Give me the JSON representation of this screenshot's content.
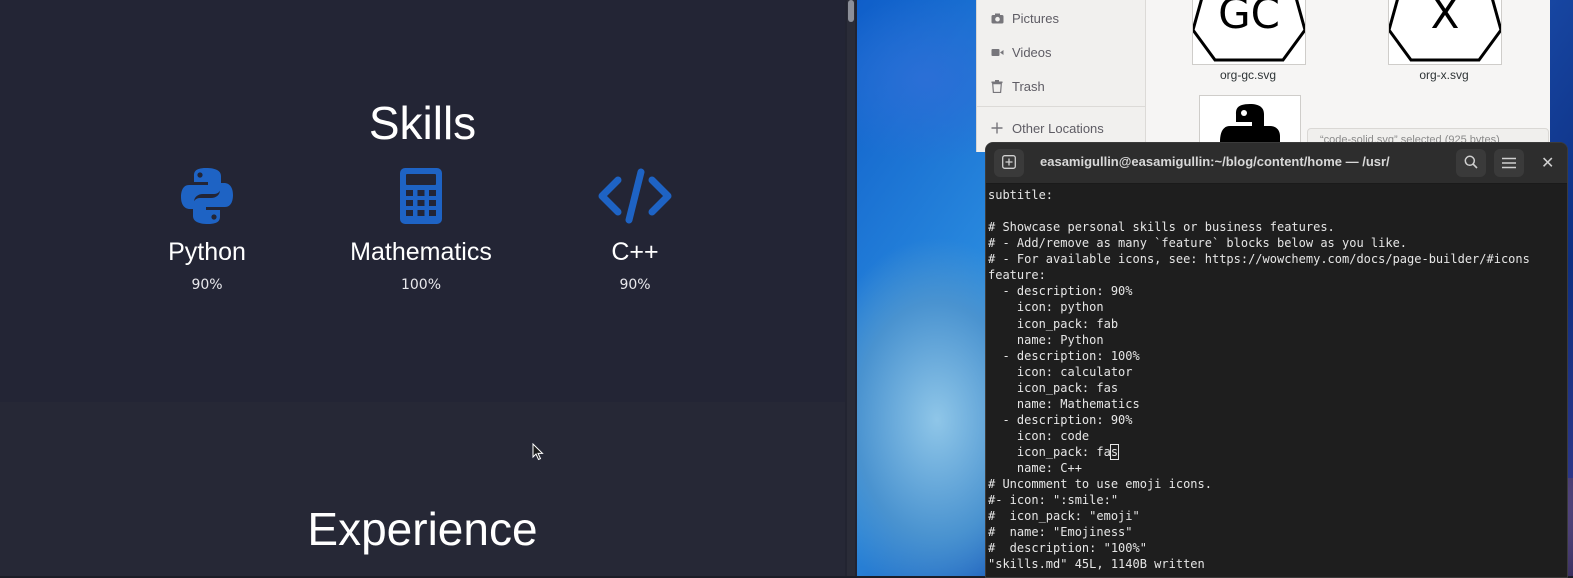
{
  "browser": {
    "skills_title": "Skills",
    "experience_title": "Experience",
    "features": [
      {
        "name": "Python",
        "description": "90%",
        "icon": "python-icon"
      },
      {
        "name": "Mathematics",
        "description": "100%",
        "icon": "calculator-icon"
      },
      {
        "name": "C++",
        "description": "90%",
        "icon": "code-icon"
      }
    ],
    "icon_color": "#1e63c4"
  },
  "file_manager": {
    "sidebar": [
      {
        "label": "Pictures",
        "icon": "camera-icon"
      },
      {
        "label": "Videos",
        "icon": "video-icon"
      },
      {
        "label": "Trash",
        "icon": "trash-icon"
      },
      {
        "label": "Other Locations",
        "icon": "plus-icon"
      }
    ],
    "files": [
      {
        "name": "org-gc.svg",
        "glyph": "GC"
      },
      {
        "name": "org-x.svg",
        "glyph": "X"
      }
    ],
    "status": "“code-solid.svg” selected (925 bytes)"
  },
  "terminal": {
    "title": "easamigullin@easamigullin:~/blog/content/home — /usr/libexe...",
    "lines": [
      "subtitle:",
      "",
      "# Showcase personal skills or business features.",
      "# - Add/remove as many `feature` blocks below as you like.",
      "# - For available icons, see: https://wowchemy.com/docs/page-builder/#icons",
      "feature:",
      "  - description: 90%",
      "    icon: python",
      "    icon_pack: fab",
      "    name: Python",
      "  - description: 100%",
      "    icon: calculator",
      "    icon_pack: fas",
      "    name: Mathematics",
      "  - description: 90%",
      "    icon: code",
      "    icon_pack: fa",
      "    name: C++",
      "# Uncomment to use emoji icons.",
      "#- icon: \":smile:\"",
      "#  icon_pack: \"emoji\"",
      "#  name: \"Emojiness\"",
      "#  description: \"100%\"",
      "\"skills.md\" 45L, 1140B written"
    ],
    "caret_char": "s"
  }
}
